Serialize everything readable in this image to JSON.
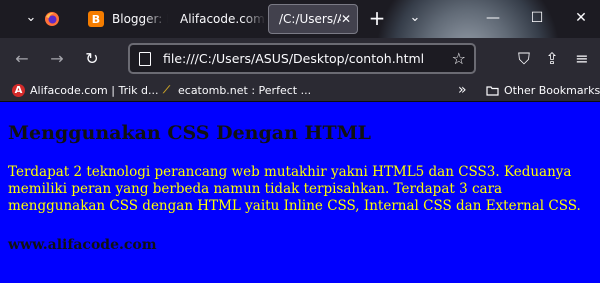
{
  "tabs": [
    {
      "label": "",
      "favicon": "firefox-view-icon",
      "active": false
    },
    {
      "label": "Blogger: P",
      "favicon": "blogger-icon",
      "color": "#f57d00",
      "active": false
    },
    {
      "label": "Alifacode.com",
      "favicon": "alifacode-icon",
      "active": false
    },
    {
      "label": "/C:/Users/A",
      "favicon": "",
      "active": true,
      "close_icon": "✕"
    }
  ],
  "tab_controls": {
    "new_tab": "+",
    "list_all_tabs": "⌄"
  },
  "window_controls": {
    "minimize": "—",
    "maximize": "☐",
    "close": "✕"
  },
  "navbar": {
    "back": "←",
    "forward": "→",
    "reload": "↻",
    "url": "file:///C:/Users/ASUS/Desktop/contoh.html",
    "bookmark_star": "☆",
    "extensions": "⇪",
    "menu": "≡",
    "shield": "⛉"
  },
  "bookmarks": [
    {
      "label": "Alifacode.com | Trik d...",
      "icon": "A",
      "color": "#d42a2a"
    },
    {
      "label": "ecatomb.net : Perfect ...",
      "icon": "⟋",
      "color": "#c9a227"
    }
  ],
  "bookmarks_overflow": "»",
  "other_bookmarks": {
    "label": "Other Bookmarks",
    "icon": "folder-icon"
  },
  "page": {
    "heading": "Menggunakan CSS Dengan HTML",
    "paragraph": "Terdapat 2 teknologi perancang web mutakhir yakni HTML5 dan CSS3. Keduanya memiliki peran yang berbeda namun tidak terpisahkan. Terdapat 3 cara menggunakan CSS dengan HTML yaitu Inline CSS, Internal CSS dan External CSS.",
    "footer": "www.alifacode.com",
    "background_color": "#0000ff",
    "text_color": "#ffff00"
  }
}
